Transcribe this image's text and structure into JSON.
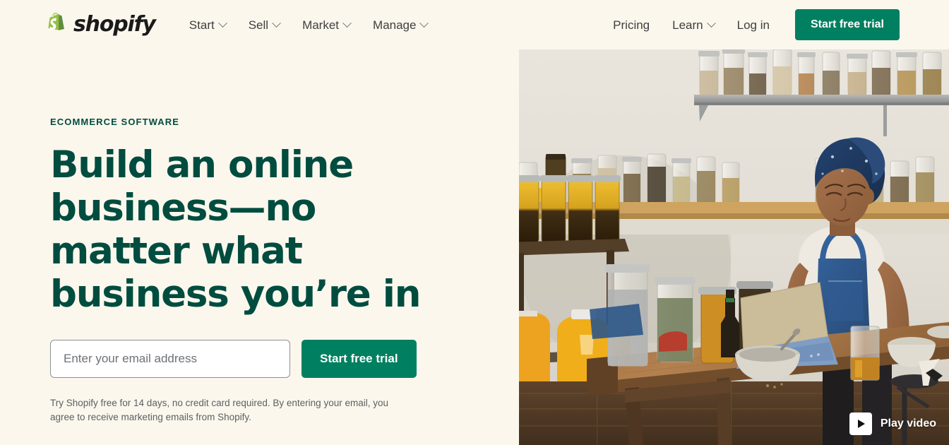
{
  "theme": {
    "background": "#FBF7ED",
    "brand_green": "#008060",
    "headline_green": "#004C3F",
    "logo_green": "#95BF47"
  },
  "navbar": {
    "logo": {
      "icon": "shopify-bag-icon",
      "wordmark": "shopify"
    },
    "primary_items": [
      {
        "label": "Start",
        "icon": "chevron-down-icon"
      },
      {
        "label": "Sell",
        "icon": "chevron-down-icon"
      },
      {
        "label": "Market",
        "icon": "chevron-down-icon"
      },
      {
        "label": "Manage",
        "icon": "chevron-down-icon"
      }
    ],
    "right_items": [
      {
        "label": "Pricing",
        "has_chevron": false
      },
      {
        "label": "Learn",
        "has_chevron": true,
        "icon": "chevron-down-icon"
      },
      {
        "label": "Log in",
        "has_chevron": false
      }
    ],
    "cta_label": "Start free trial"
  },
  "hero": {
    "eyebrow": "ECOMMERCE SOFTWARE",
    "headline": "Build an online business—no matter what business you’re in",
    "email_placeholder": "Enter your email address",
    "email_value": "",
    "cta_label": "Start free trial",
    "fineprint": "Try Shopify free for 14 days, no credit card required. By entering your email, you agree to receive marketing emails from Shopify."
  },
  "media": {
    "alt": "Maker in blue headwrap and apron working on a tablet at a wooden table surrounded by shelves of glass jars",
    "play_video_label": "Play video",
    "play_icon": "play-triangle-icon"
  }
}
